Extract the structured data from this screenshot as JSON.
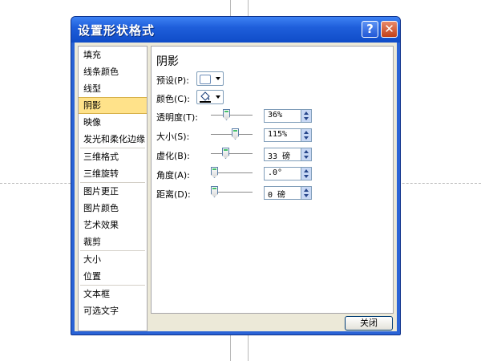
{
  "dialog": {
    "title": "设置形状格式",
    "help_label": "?",
    "close_label": "✕",
    "close_button_label": "关闭"
  },
  "nav": {
    "selected": "阴影",
    "items": [
      {
        "label": "填充"
      },
      {
        "label": "线条颜色"
      },
      {
        "label": "线型"
      },
      {
        "label": "阴影"
      },
      {
        "label": "映像"
      },
      {
        "label": "发光和柔化边缘"
      },
      {
        "label": "三维格式"
      },
      {
        "label": "三维旋转"
      },
      {
        "label": "图片更正"
      },
      {
        "label": "图片颜色"
      },
      {
        "label": "艺术效果"
      },
      {
        "label": "裁剪"
      },
      {
        "label": "大小"
      },
      {
        "label": "位置"
      },
      {
        "label": "文本框"
      },
      {
        "label": "可选文字"
      }
    ]
  },
  "panel": {
    "title": "阴影",
    "preset": {
      "label": "预设(P):",
      "icon": "shadow-preset-icon"
    },
    "color": {
      "label": "颜色(C):",
      "icon": "paint-bucket-icon"
    },
    "transparency": {
      "label": "透明度(T):",
      "value": "36%",
      "slider_fraction": 0.36
    },
    "size": {
      "label": "大小(S):",
      "value": "115%",
      "slider_fraction": 0.6
    },
    "blur": {
      "label": "虚化(B):",
      "value": "33 磅",
      "slider_fraction": 0.33
    },
    "angle": {
      "label": "角度(A):",
      "value": ".0°",
      "slider_fraction": 0
    },
    "distance": {
      "label": "距离(D):",
      "value": "0 磅",
      "slider_fraction": 0
    }
  },
  "colors": {
    "titlebar": "#1f5fdb",
    "selected_item": "#ffe28a",
    "slider_accent": "#45c06b"
  }
}
